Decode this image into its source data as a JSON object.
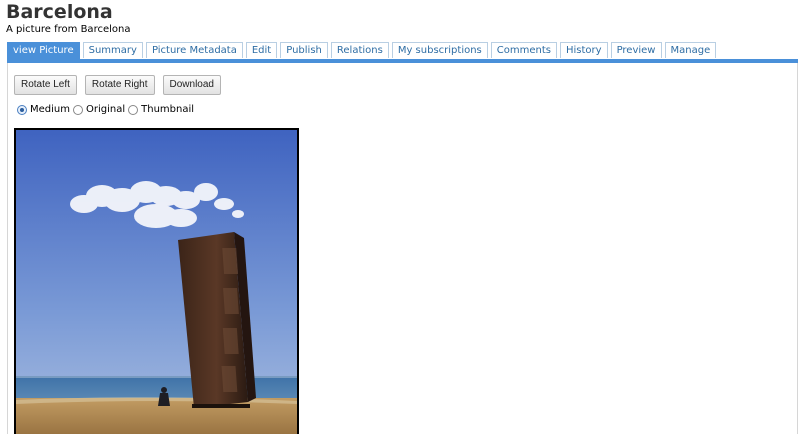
{
  "header": {
    "title": "Barcelona",
    "subtitle": "A picture from Barcelona"
  },
  "tabs": [
    {
      "label": "view Picture",
      "active": true
    },
    {
      "label": "Summary",
      "active": false
    },
    {
      "label": "Picture Metadata",
      "active": false
    },
    {
      "label": "Edit",
      "active": false
    },
    {
      "label": "Publish",
      "active": false
    },
    {
      "label": "Relations",
      "active": false
    },
    {
      "label": "My subscriptions",
      "active": false
    },
    {
      "label": "Comments",
      "active": false
    },
    {
      "label": "History",
      "active": false
    },
    {
      "label": "Preview",
      "active": false
    },
    {
      "label": "Manage",
      "active": false
    }
  ],
  "toolbar": {
    "rotate_left": "Rotate Left",
    "rotate_right": "Rotate Right",
    "download": "Download"
  },
  "size_options": {
    "medium": "Medium",
    "original": "Original",
    "thumbnail": "Thumbnail",
    "selected": "Medium"
  },
  "colors": {
    "accent": "#4a90d9",
    "tab_text": "#2e6da4",
    "sky": "#5f82cc",
    "sand": "#b08a52",
    "sea": "#3b6da0"
  }
}
